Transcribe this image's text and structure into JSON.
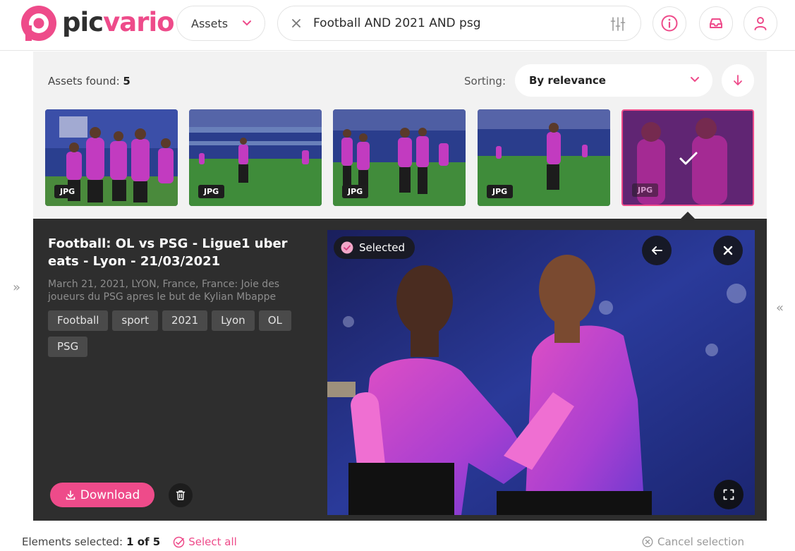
{
  "brand": {
    "name_part1": "pic",
    "name_part2": "vario",
    "accent": "#ee4b8a"
  },
  "header": {
    "scope": "Assets",
    "search_query": "Football AND 2021 AND psg",
    "icons": [
      "chevron-down-icon",
      "close-icon",
      "filter-sliders-icon",
      "info-icon",
      "inbox-icon",
      "user-icon"
    ]
  },
  "results": {
    "found_label": "Assets found:",
    "found_count": "5",
    "sorting_label": "Sorting:",
    "sorting_value": "By relevance",
    "thumbnails": [
      {
        "type": "JPG",
        "selected": false
      },
      {
        "type": "JPG",
        "selected": false
      },
      {
        "type": "JPG",
        "selected": false
      },
      {
        "type": "JPG",
        "selected": false
      },
      {
        "type": "JPG",
        "selected": true
      }
    ]
  },
  "detail": {
    "title": "Football: OL vs PSG - Ligue1 uber eats - Lyon - 21/03/2021",
    "description": "March 21, 2021, LYON, France, France: Joie des joueurs du PSG apres le but de Kylian Mbappe",
    "tags": [
      "Football",
      "sport",
      "2021",
      "Lyon",
      "OL",
      "PSG"
    ],
    "download_label": "Download",
    "selected_badge": "Selected"
  },
  "footer": {
    "selected_label": "Elements selected:",
    "selected_value": "1 of 5",
    "select_all": "Select all",
    "cancel_selection": "Cancel selection"
  },
  "side_arrows": {
    "left": "»",
    "right": "«"
  }
}
